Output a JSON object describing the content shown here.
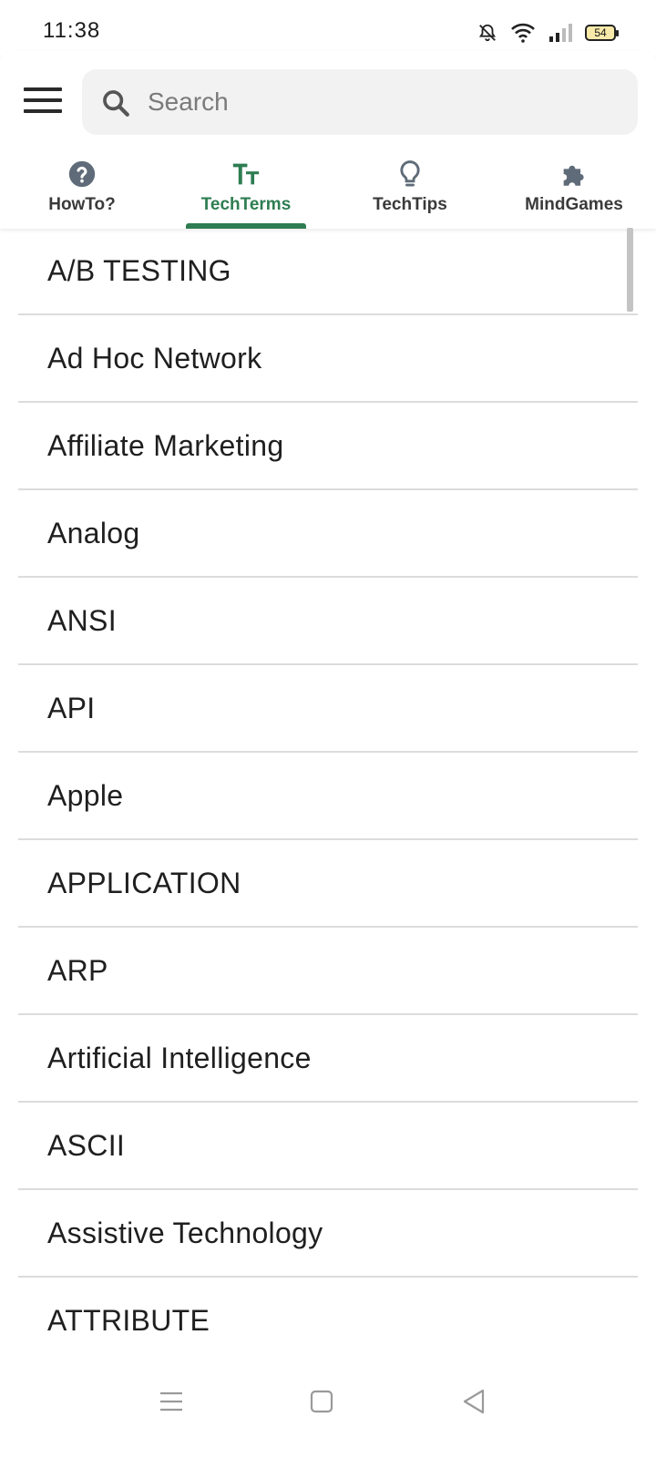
{
  "status_bar": {
    "time": "11:38",
    "battery": "54",
    "icons": [
      "bell-off-icon",
      "wifi-icon",
      "signal-icon",
      "battery-icon"
    ]
  },
  "header": {
    "menu_icon": "hamburger-menu-icon",
    "search": {
      "placeholder": "Search",
      "value": "",
      "icon": "search-icon"
    },
    "tabs": [
      {
        "label": "HowTo?",
        "icon": "question-circle-icon",
        "active": false
      },
      {
        "label": "TechTerms",
        "icon": "text-size-icon",
        "active": true
      },
      {
        "label": "TechTips",
        "icon": "lightbulb-icon",
        "active": false
      },
      {
        "label": "MindGames",
        "icon": "puzzle-icon",
        "active": false
      }
    ]
  },
  "terms": [
    "A/B TESTING",
    "Ad Hoc Network",
    "Affiliate Marketing",
    "Analog",
    "ANSI",
    "API",
    "Apple",
    "APPLICATION",
    "ARP",
    "Artificial Intelligence",
    "ASCII",
    "Assistive Technology",
    "ATTRIBUTE"
  ],
  "nav_bar": {
    "buttons": [
      "recent-apps-icon",
      "home-icon",
      "back-icon"
    ]
  },
  "colors": {
    "accent": "#2e7d52",
    "inactive_icon": "#5f6b78",
    "divider": "#dcdcdc",
    "search_bg": "#f2f2f2"
  }
}
